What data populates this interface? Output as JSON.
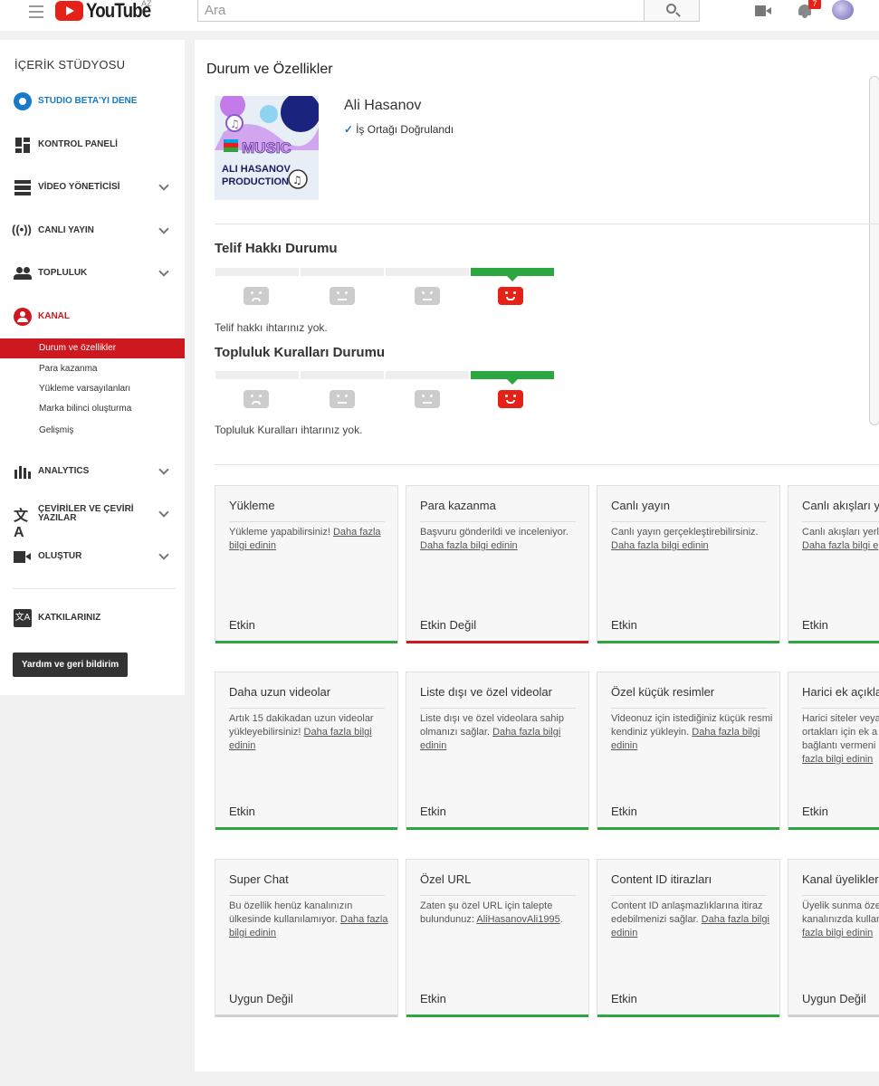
{
  "topbar": {
    "logo_text": "YouTube",
    "region": "AZ",
    "search_placeholder": "Ara",
    "notification_count": "7"
  },
  "sidebar": {
    "title": "İÇERİK STÜDYOSU",
    "items": [
      {
        "label": "STUDIO BETA'YI DENE"
      },
      {
        "label": "KONTROL PANELİ"
      },
      {
        "label": "VİDEO YÖNETİCİSİ"
      },
      {
        "label": "CANLI YAYIN"
      },
      {
        "label": "TOPLULUK"
      },
      {
        "label": "KANAL"
      },
      {
        "label": "ANALYTICS"
      },
      {
        "label": "ÇEVİRİLER VE ÇEVİRİ YAZILAR"
      },
      {
        "label": "OLUŞTUR"
      },
      {
        "label": "KATKILARINIZ"
      }
    ],
    "subitems": [
      {
        "label": "Durum ve özellikler"
      },
      {
        "label": "Para kazanma"
      },
      {
        "label": "Yükleme varsayılanları"
      },
      {
        "label": "Marka bilinci oluşturma"
      },
      {
        "label": "Gelişmiş"
      }
    ],
    "help_button": "Yardım ve geri bildirim"
  },
  "main": {
    "title": "Durum ve Özellikler",
    "channel": {
      "name": "Ali Hasanov",
      "verified": "İş Ortağı Doğrulandı",
      "thumb_text_1": "MUSIC",
      "thumb_text_2": "ALI HASANOV",
      "thumb_text_3": "PRODUCTION"
    },
    "copyright": {
      "title": "Telif Hakkı Durumu",
      "text": "Telif hakkı ihtarınız yok.",
      "level": 4
    },
    "community": {
      "title": "Topluluk Kuralları Durumu",
      "text": "Topluluk Kuralları ihtarınız yok.",
      "level": 4
    },
    "cards": [
      {
        "title": "Yükleme",
        "desc": "Yükleme yapabilirsiniz! ",
        "link": "Daha fazla bilgi edinin",
        "status": "Etkin"
      },
      {
        "title": "Para kazanma",
        "desc": "Başvuru gönderildi ve inceleniyor. ",
        "link": "Daha fazla bilgi edinin",
        "status": "Etkin Değil"
      },
      {
        "title": "Canlı yayın",
        "desc": "Canlı yayın gerçekleştirebilirsiniz. ",
        "link": "Daha fazla bilgi edinin",
        "status": "Etkin"
      },
      {
        "title": "Canlı akışları y",
        "desc": "Canlı akışları yerl",
        "link": "Daha fazla bilgi e",
        "status": "Etkin"
      },
      {
        "title": "Daha uzun videolar",
        "desc": "Artık 15 dakikadan uzun videolar yükleyebilirsiniz! ",
        "link": "Daha fazla bilgi edinin",
        "status": "Etkin"
      },
      {
        "title": "Liste dışı ve özel videolar",
        "desc": "Liste dışı ve özel videolara sahip olmanızı sağlar. ",
        "link": "Daha fazla bilgi edinin",
        "status": "Etkin"
      },
      {
        "title": "Özel küçük resimler",
        "desc": "Videonuz için istediğiniz küçük resmi kendiniz yükleyin. ",
        "link": "Daha fazla bilgi edinin",
        "status": "Etkin"
      },
      {
        "title": "Harici ek açıkla",
        "desc": "Harici siteler veya ortakları için ek a bağlantı vermeni ",
        "link": "fazla bilgi edinin",
        "status": "Etkin"
      },
      {
        "title": "Super Chat",
        "desc": "Bu özellik henüz kanalınızın ülkesinde kullanılamıyor. ",
        "link": "Daha fazla bilgi edinin",
        "status": "Uygun Değil"
      },
      {
        "title": "Özel URL",
        "desc": "Zaten şu özel URL için talepte bulundunuz: ",
        "link": "AliHasanovAli1995",
        "tail": ".",
        "status": "Etkin"
      },
      {
        "title": "Content ID itirazları",
        "desc": "Content ID anlaşmazlıklarına itiraz edebilmenizi sağlar. ",
        "link": "Daha fazla bilgi edinin",
        "status": "Etkin"
      },
      {
        "title": "Kanal üyelikler",
        "desc": "Üyelik sunma öze kanalınızda kullan ",
        "link": "fazla bilgi edinin",
        "status": "Uygun Değil"
      }
    ]
  }
}
